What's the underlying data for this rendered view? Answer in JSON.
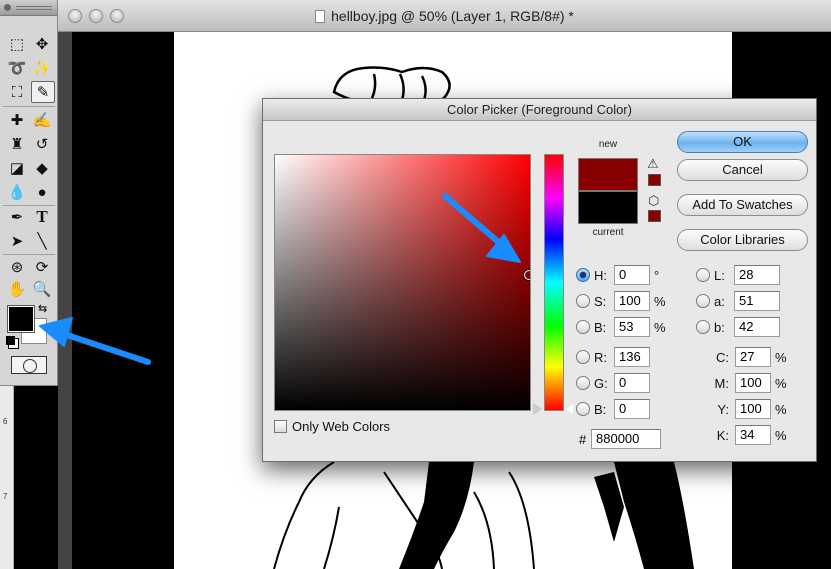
{
  "document": {
    "title": "hellboy.jpg @ 50% (Layer 1, RGB/8#) *",
    "ruler_marks": [
      "6",
      "7"
    ]
  },
  "toolbox": {
    "foreground_color": "#000000",
    "background_color": "#ffffff"
  },
  "dialog": {
    "title": "Color Picker (Foreground Color)",
    "new_label": "new",
    "current_label": "current",
    "new_color": "#880000",
    "current_color": "#000000",
    "buttons": {
      "ok": "OK",
      "cancel": "Cancel",
      "add_to_swatches": "Add To Swatches",
      "color_libraries": "Color Libraries"
    },
    "hsb": {
      "h_label": "H:",
      "h_value": "0",
      "h_unit": "°",
      "s_label": "S:",
      "s_value": "100",
      "s_unit": "%",
      "b_label": "B:",
      "b_value": "53",
      "b_unit": "%",
      "selected": "H"
    },
    "rgb": {
      "r_label": "R:",
      "r_value": "136",
      "g_label": "G:",
      "g_value": "0",
      "b_label": "B:",
      "b_value": "0"
    },
    "lab": {
      "l_label": "L:",
      "l_value": "28",
      "a_label": "a:",
      "a_value": "51",
      "b_label": "b:",
      "b_value": "42"
    },
    "cmyk": {
      "c_label": "C:",
      "c_value": "27",
      "c_unit": "%",
      "m_label": "M:",
      "m_value": "100",
      "m_unit": "%",
      "y_label": "Y:",
      "y_value": "100",
      "y_unit": "%",
      "k_label": "K:",
      "k_value": "34",
      "k_unit": "%"
    },
    "hex": {
      "label": "#",
      "value": "880000"
    },
    "only_web_colors": {
      "label": "Only Web Colors",
      "checked": false
    },
    "field": {
      "hue_color": "#ff0000",
      "marker_saturation": 1.0,
      "marker_brightness": 0.53
    },
    "hue_slider": {
      "value": 0
    }
  },
  "annotation": {
    "arrow_color": "#1a8cff"
  }
}
